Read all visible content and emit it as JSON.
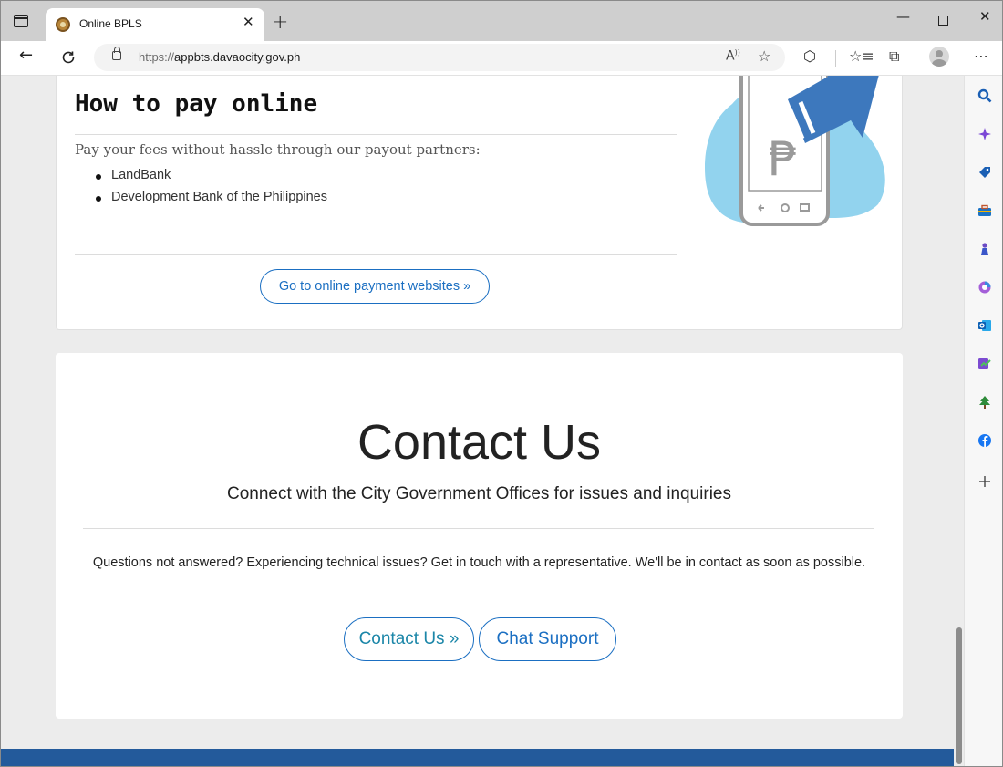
{
  "browser": {
    "tab_title": "Online BPLS",
    "url_scheme": "https://",
    "url_host": "appbts.davaocity.gov.ph",
    "sidebar_icons": [
      "search-icon",
      "copilot-icon",
      "shopping-tag-icon",
      "tools-briefcase-icon",
      "games-icon",
      "microsoft365-icon",
      "outlook-icon",
      "drop-icon",
      "tree-icon",
      "facebook-icon",
      "add-icon"
    ]
  },
  "payment": {
    "title": "How to pay online",
    "lead": "Pay your fees without hassle through our payout partners:",
    "partners": [
      "LandBank",
      "Development Bank of the Philippines"
    ],
    "button_label": "Go to online payment websites »",
    "illustration_symbol": "₱"
  },
  "contact": {
    "title": "Contact Us",
    "subtitle": "Connect with the City Government Offices for issues and inquiries",
    "body": "Questions not answered? Experiencing technical issues? Get in touch with a representative. We'll be in contact as soon as possible.",
    "contact_button": "Contact Us »",
    "chat_button": "Chat Support"
  },
  "colors": {
    "accent": "#1b6fc2",
    "footer": "#235a9b",
    "illustration_blue": "#3d78bd",
    "illustration_light": "#92d3ee"
  }
}
